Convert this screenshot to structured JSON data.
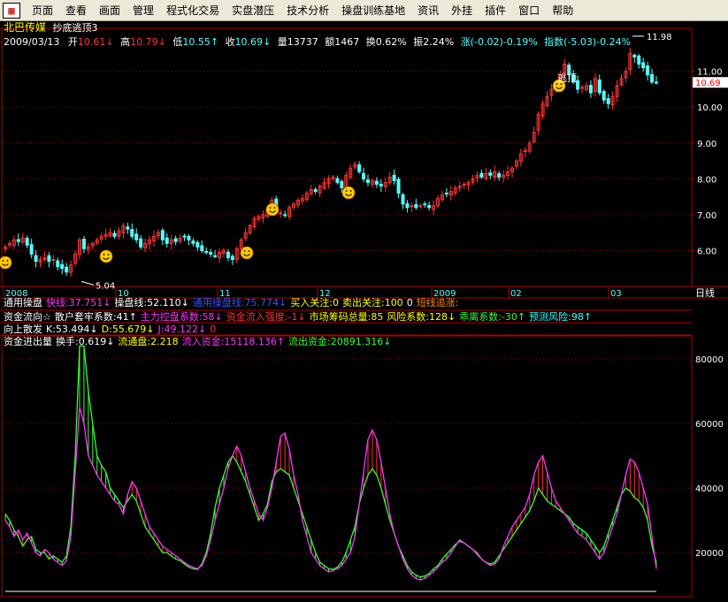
{
  "menu": {
    "app_icon_glyph": "▦",
    "items": [
      "页面",
      "查看",
      "画面",
      "管理",
      "程式化交易",
      "实盘潜压",
      "技术分析",
      "操盘训练基地",
      "资讯",
      "外挂",
      "插件",
      "窗口",
      "帮助"
    ]
  },
  "stock": {
    "name": "北巴传媒",
    "indicator": "抄底逃顶3",
    "date": "2009/03/13",
    "open_label": "开",
    "open": "10.61",
    "high_label": "高",
    "high": "10.79",
    "low_label": "低",
    "low": "10.55",
    "close_label": "收",
    "close": "10.69",
    "vol_label": "量",
    "vol": "13737",
    "amt_label": "额",
    "amt": "1467",
    "turn_label": "换",
    "turn": "0.62%",
    "amp_label": "振",
    "amp": "2.24%",
    "chg": "涨(-0.02)-0.19%",
    "index": "指数(-5.03)-0.24%",
    "current_price": "10.69",
    "max_label": "11.98",
    "min_label": "5.04",
    "escape_label": "逃顶"
  },
  "price_axis": [
    "11.00",
    "10.00",
    "9.00",
    "8.00",
    "7.00",
    "6.00"
  ],
  "price_ylim": [
    5.0,
    12.2
  ],
  "vol_axis": [
    "80000",
    "60000",
    "40000",
    "20000"
  ],
  "vol_ylim": [
    8000,
    86000
  ],
  "date_axis": [
    "2008",
    "10",
    "11",
    "12",
    "2009",
    "02",
    "03"
  ],
  "period_label": "日线",
  "lines": {
    "l1": [
      {
        "t": "通用操盘",
        "c": "#ffffff"
      },
      {
        "t": "快线:37.751↓",
        "c": "#ff33ff"
      },
      {
        "t": "操盘线:52.110↓",
        "c": "#ffffff"
      },
      {
        "t": "通用操盘线:75.774↓",
        "c": "#3355ff"
      },
      {
        "t": "买入关注:0",
        "c": "#ffff00"
      },
      {
        "t": "卖出关注:100",
        "c": "#ffff00"
      },
      {
        "t": "0",
        "c": "#ffffff"
      },
      {
        "t": "短线追涨:",
        "c": "#ff8800"
      }
    ],
    "l2": [
      {
        "t": "资金流向☆",
        "c": "#ffffff"
      },
      {
        "t": "散户套牢系数:41↑",
        "c": "#ffffff"
      },
      {
        "t": "主力控盘系数:58↓",
        "c": "#ff33ff"
      },
      {
        "t": "资金流入强度:-1↓",
        "c": "#ff3333"
      },
      {
        "t": "市场筹码总量:85",
        "c": "#ffff00"
      },
      {
        "t": "风险系数:128↓",
        "c": "#ffff00"
      },
      {
        "t": "乖离系数:-30↑",
        "c": "#33ff33"
      },
      {
        "t": "预测风险:98↑",
        "c": "#33ffff"
      }
    ],
    "l3": [
      {
        "t": "向上散发",
        "c": "#ffffff"
      },
      {
        "t": "K:53.494↓",
        "c": "#ffffff"
      },
      {
        "t": "D:55.679↓",
        "c": "#ffff00"
      },
      {
        "t": "J:49.122↓",
        "c": "#ff33ff"
      },
      {
        "t": "0",
        "c": "#ff3333"
      }
    ],
    "l4": [
      {
        "t": "资金进出量",
        "c": "#ffffff"
      },
      {
        "t": "换手:0.619↓",
        "c": "#ffffff"
      },
      {
        "t": "流通盘:2.218",
        "c": "#ffff00"
      },
      {
        "t": "流入资金:15118.136↑",
        "c": "#ff33ff"
      },
      {
        "t": "流出资金:20891.316↓",
        "c": "#33ff33"
      }
    ]
  },
  "colors": {
    "up": "#ff3333",
    "down": "#54ffff",
    "grid": "#aa0000",
    "inflow": "#ff33ff",
    "outflow": "#33ff33"
  },
  "chart_data": {
    "type": "candlestick",
    "closes": [
      6.1,
      6.2,
      6.3,
      6.25,
      6.35,
      6.15,
      5.9,
      5.7,
      5.75,
      5.8,
      5.7,
      5.75,
      5.55,
      5.5,
      5.4,
      5.6,
      5.9,
      6.3,
      6.05,
      6.1,
      6.2,
      6.3,
      6.4,
      6.45,
      6.5,
      6.4,
      6.55,
      6.7,
      6.6,
      6.4,
      6.3,
      6.1,
      6.2,
      6.3,
      6.4,
      6.5,
      6.3,
      6.2,
      6.3,
      6.25,
      6.35,
      6.4,
      6.3,
      6.2,
      6.1,
      6.0,
      5.95,
      5.9,
      5.85,
      5.95,
      6.0,
      5.8,
      5.75,
      6.05,
      6.3,
      6.5,
      6.7,
      6.9,
      6.95,
      7.0,
      7.15,
      7.4,
      7.1,
      7.05,
      7.0,
      7.2,
      7.3,
      7.4,
      7.45,
      7.6,
      7.7,
      7.65,
      7.8,
      7.9,
      8.0,
      8.05,
      7.9,
      7.75,
      8.1,
      8.3,
      8.4,
      8.2,
      8.0,
      7.9,
      7.95,
      7.85,
      7.8,
      7.9,
      8.05,
      7.95,
      7.6,
      7.3,
      7.2,
      7.25,
      7.2,
      7.25,
      7.3,
      7.2,
      7.25,
      7.45,
      7.55,
      7.6,
      7.65,
      7.75,
      7.8,
      7.85,
      7.9,
      8.0,
      8.1,
      8.05,
      8.15,
      8.1,
      8.2,
      8.05,
      8.1,
      8.2,
      8.3,
      8.5,
      8.7,
      8.8,
      9.0,
      9.3,
      9.8,
      10.1,
      10.3,
      10.5,
      10.7,
      10.9,
      11.2,
      10.9,
      10.7,
      10.5,
      10.55,
      10.6,
      10.4,
      10.8,
      10.4,
      10.2,
      10.1,
      10.3,
      10.6,
      10.8,
      11.0,
      11.5,
      11.4,
      11.2,
      11.1,
      10.9,
      10.7,
      10.69
    ],
    "inflow": [
      30000,
      28000,
      25000,
      27000,
      24000,
      26000,
      23000,
      20000,
      19000,
      21000,
      20000,
      18000,
      17000,
      16000,
      17500,
      25000,
      45000,
      65000,
      60000,
      50000,
      47000,
      44000,
      42000,
      40000,
      38000,
      36000,
      35000,
      32000,
      38000,
      42000,
      40000,
      36000,
      32000,
      28000,
      26000,
      24000,
      22000,
      21000,
      20000,
      19000,
      18000,
      17000,
      16000,
      15500,
      15000,
      16000,
      19000,
      24000,
      30000,
      35000,
      40000,
      46000,
      50000,
      53000,
      50000,
      45000,
      40000,
      36000,
      32000,
      30000,
      34000,
      40000,
      48000,
      56000,
      57000,
      52000,
      44000,
      38000,
      30000,
      25000,
      20000,
      18000,
      16000,
      15000,
      14000,
      14500,
      15000,
      16000,
      18000,
      20000,
      25000,
      35000,
      45000,
      55000,
      58000,
      55000,
      48000,
      40000,
      32000,
      26000,
      22000,
      18000,
      15000,
      13000,
      12000,
      11500,
      12000,
      13000,
      14000,
      15500,
      17000,
      18000,
      20000,
      22000,
      24000,
      23000,
      22000,
      21000,
      20000,
      18000,
      17000,
      16000,
      16500,
      18000,
      22000,
      25000,
      28000,
      30000,
      32000,
      34000,
      38000,
      44000,
      48000,
      50000,
      45000,
      40000,
      36000,
      34000,
      32000,
      30000,
      28000,
      26000,
      25000,
      24000,
      22000,
      20000,
      18000,
      20000,
      24000,
      28000,
      32000,
      38000,
      44000,
      49000,
      48000,
      45000,
      40000,
      35000,
      25000,
      15000
    ],
    "outflow": [
      32000,
      30000,
      27000,
      25000,
      22000,
      24000,
      25000,
      21000,
      20000,
      20000,
      18000,
      19000,
      18000,
      17000,
      19000,
      28000,
      50000,
      84000,
      84000,
      70000,
      60000,
      50000,
      47000,
      45000,
      40000,
      38000,
      36000,
      34000,
      36000,
      38000,
      36000,
      32000,
      28000,
      26000,
      24000,
      22000,
      20000,
      20000,
      19000,
      18000,
      17500,
      16500,
      15500,
      15000,
      14800,
      16500,
      20000,
      26000,
      34000,
      40000,
      44000,
      48000,
      50000,
      48000,
      45000,
      42000,
      38000,
      34000,
      30000,
      32000,
      35000,
      42000,
      45000,
      46000,
      45000,
      44000,
      40000,
      36000,
      32000,
      28000,
      24000,
      20000,
      17000,
      16000,
      15000,
      14800,
      15500,
      17000,
      20000,
      24000,
      28000,
      35000,
      40000,
      44000,
      46000,
      44000,
      40000,
      35000,
      30000,
      26000,
      22000,
      19000,
      16000,
      14000,
      13000,
      12500,
      12800,
      13500,
      15000,
      16000,
      18000,
      19500,
      21000,
      22500,
      23500,
      23000,
      22000,
      21000,
      19500,
      18000,
      17000,
      16500,
      17000,
      19000,
      21000,
      23000,
      25000,
      27000,
      29000,
      31000,
      33000,
      36000,
      40000,
      38000,
      36000,
      35000,
      34000,
      33000,
      32000,
      31000,
      29000,
      28000,
      27000,
      26000,
      24000,
      22000,
      20000,
      22000,
      26000,
      30000,
      34000,
      38000,
      40000,
      39000,
      37000,
      36000,
      34000,
      30000,
      22000,
      17000
    ]
  }
}
